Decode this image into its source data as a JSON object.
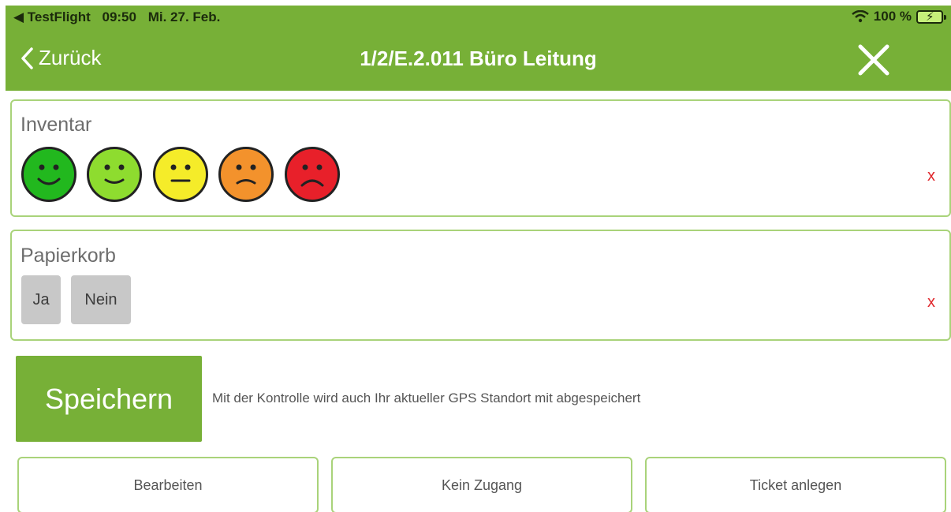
{
  "status_bar": {
    "back_app": "◀ TestFlight",
    "time": "09:50",
    "date": "Mi. 27. Feb.",
    "wifi_icon": "wifi-icon",
    "battery": "100 %"
  },
  "nav": {
    "back_label": "Zurück",
    "title": "1/2/E.2.011 Büro Leitung",
    "close_icon": "close-icon"
  },
  "inventar": {
    "title": "Inventar",
    "clear_label": "x",
    "ratings": [
      {
        "name": "very-happy",
        "color": "#22b81e"
      },
      {
        "name": "happy",
        "color": "#8edc2f"
      },
      {
        "name": "neutral",
        "color": "#f5ec29"
      },
      {
        "name": "sad",
        "color": "#f3922c"
      },
      {
        "name": "very-sad",
        "color": "#e8202a"
      }
    ]
  },
  "papierkorb": {
    "title": "Papierkorb",
    "clear_label": "x",
    "yes_label": "Ja",
    "no_label": "Nein"
  },
  "save": {
    "label": "Speichern",
    "note": "Mit der Kontrolle wird auch Ihr aktueller GPS Standort mit abgespeichert"
  },
  "actions": {
    "edit_label": "Bearbeiten",
    "no_access_label": "Kein Zugang",
    "ticket_label": "Ticket anlegen"
  },
  "colors": {
    "accent": "#77b037",
    "border": "#a9d37a",
    "clear": "#e0262b"
  }
}
